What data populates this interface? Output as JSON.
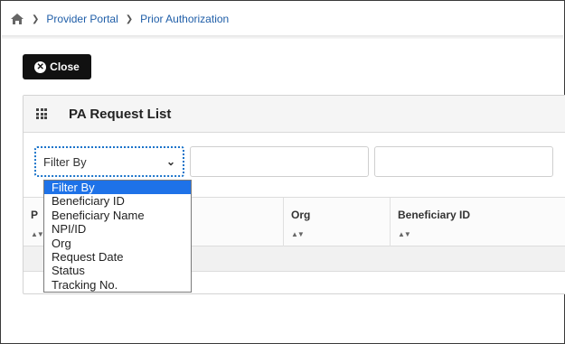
{
  "breadcrumb": {
    "items": [
      "Provider Portal",
      "Prior Authorization"
    ]
  },
  "toolbar": {
    "close_label": "Close"
  },
  "panel": {
    "title": "PA Request List"
  },
  "filter": {
    "selected": "Filter By",
    "options": [
      "Filter By",
      "Beneficiary ID",
      "Beneficiary Name",
      "NPI/ID",
      "Org",
      "Request Date",
      "Status",
      "Tracking No."
    ]
  },
  "table": {
    "columns": [
      "P",
      "Org",
      "Beneficiary ID"
    ],
    "sort_glyph": "▲▼"
  },
  "colors": {
    "link": "#1f5ea8",
    "selected_option": "#1e72e8",
    "close_button": "#111111"
  }
}
